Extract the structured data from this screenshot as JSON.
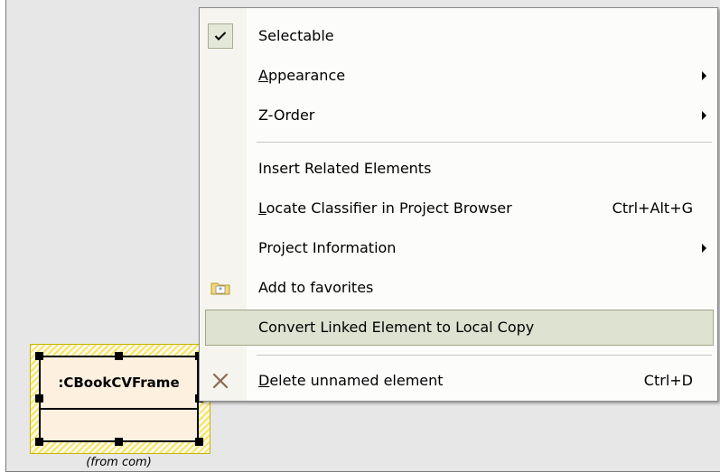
{
  "diagram": {
    "element_name": ":CBookCVFrame",
    "from_label": "(from com)"
  },
  "context_menu": {
    "items": [
      {
        "name": "selectable",
        "label": "Selectable",
        "checked": true,
        "icon": "check-icon"
      },
      {
        "name": "appearance",
        "label_hotkey": "A",
        "label_rest": "ppearance",
        "submenu": true
      },
      {
        "name": "z-order",
        "label": "Z-Order",
        "submenu": true
      },
      {
        "name": "insert-related-elements",
        "label": "Insert Related Elements"
      },
      {
        "name": "locate-classifier",
        "label_hotkey": "L",
        "label_rest": "ocate Classifier in Project Browser",
        "shortcut": "Ctrl+Alt+G"
      },
      {
        "name": "project-information",
        "label": "Project Information",
        "submenu": true
      },
      {
        "name": "add-to-favorites",
        "label": "Add to favorites",
        "icon": "favorites-folder-icon"
      },
      {
        "name": "convert-linked-element",
        "label": "Convert Linked Element to Local Copy",
        "highlighted": true
      },
      {
        "name": "delete-unnamed-element",
        "label_hotkey": "D",
        "label_rest": "elete unnamed element",
        "shortcut": "Ctrl+D",
        "icon": "delete-x-icon"
      }
    ]
  },
  "colors": {
    "canvas": "#e7e7e7",
    "menu_background": "#fcfcfb",
    "highlight": "#dde2d1",
    "element_fill": "#fdf0df",
    "selection_hatch": "#f6e36b"
  }
}
